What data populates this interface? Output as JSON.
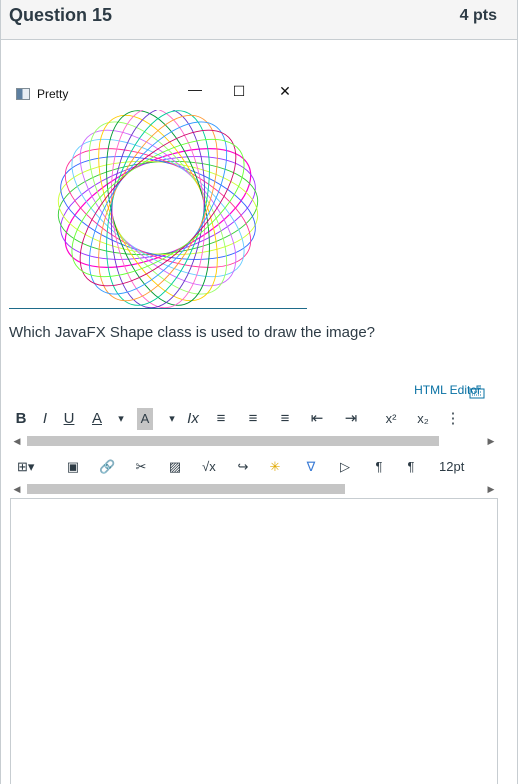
{
  "question": {
    "title": "Question 15",
    "points": "4 pts",
    "text": "Which JavaFX Shape class is used to draw the image?"
  },
  "app_window": {
    "title": "Pretty",
    "minimize_glyph": "—",
    "maximize_glyph": "☐",
    "close_glyph": "✕",
    "ellipse_colors": [
      "#ff00cc",
      "#9933ff",
      "#33cc33",
      "#ccff33",
      "#3366ff",
      "#ff3399",
      "#66ccff",
      "#cc66ff",
      "#99ff66",
      "#ffcc00",
      "#009933",
      "#ff66cc",
      "#6633cc",
      "#00cc99",
      "#ff9933",
      "#3399ff",
      "#cc0066",
      "#66ff33"
    ],
    "baseline_color": "#1e6b8a"
  },
  "editor": {
    "html_editor_label": "HTML Editor",
    "toolbar1": [
      {
        "name": "bold-button",
        "label": "B"
      },
      {
        "name": "italic-button",
        "label": "I"
      },
      {
        "name": "underline-button",
        "label": "U"
      },
      {
        "name": "text-color-button",
        "label": "A"
      },
      {
        "name": "text-color-dropdown",
        "label": "▾"
      },
      {
        "name": "background-color-button",
        "label": "A"
      },
      {
        "name": "background-color-dropdown",
        "label": "▾"
      },
      {
        "name": "clear-formatting-button",
        "label": "Ix"
      },
      {
        "name": "align-left-button",
        "label": "≡"
      },
      {
        "name": "align-center-button",
        "label": "≡"
      },
      {
        "name": "align-right-button",
        "label": "≡"
      },
      {
        "name": "outdent-button",
        "label": "⇤"
      },
      {
        "name": "indent-button",
        "label": "⇥"
      },
      {
        "name": "superscript-button",
        "label": "x²"
      },
      {
        "name": "subscript-button",
        "label": "x₂"
      },
      {
        "name": "list-button",
        "label": "⋮"
      }
    ],
    "toolbar2": [
      {
        "name": "table-button",
        "label": "⊞▾"
      },
      {
        "name": "media-button",
        "label": "▣"
      },
      {
        "name": "link-button",
        "label": "🔗"
      },
      {
        "name": "unlink-button",
        "label": "✂"
      },
      {
        "name": "image-button",
        "label": "▨"
      },
      {
        "name": "math-button",
        "label": "√x"
      },
      {
        "name": "embed-button",
        "label": "↪"
      },
      {
        "name": "spinner-button",
        "label": "✳"
      },
      {
        "name": "apps-button",
        "label": "∇"
      },
      {
        "name": "video-button",
        "label": "▷"
      },
      {
        "name": "ltr-button",
        "label": "¶"
      },
      {
        "name": "rtl-button",
        "label": "¶"
      }
    ],
    "font_size": "12pt"
  }
}
